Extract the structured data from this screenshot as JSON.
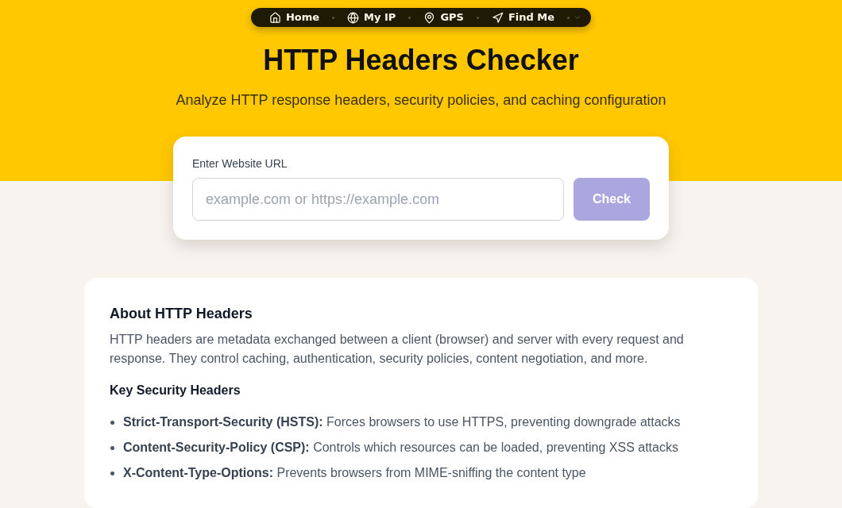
{
  "nav": {
    "items": [
      {
        "label": "Home"
      },
      {
        "label": "My IP"
      },
      {
        "label": "GPS"
      },
      {
        "label": "Find Me"
      }
    ]
  },
  "hero": {
    "title": "HTTP Headers Checker",
    "subtitle": "Analyze HTTP response headers, security policies, and caching configuration"
  },
  "url_form": {
    "label": "Enter Website URL",
    "placeholder": "example.com or https://example.com",
    "button": {
      "label": "Check",
      "disabled": true
    }
  },
  "about": {
    "title": "About HTTP Headers",
    "text": "HTTP headers are metadata exchanged between a client (browser) and server with every request and response. They control caching, authentication, security policies, content negotiation, and more.",
    "subtitle": "Key Security Headers",
    "items": [
      "**Strict-Transport-Security (HSTS):** Forces browsers to use HTTPS, preventing downgrade attacks",
      "**Content-Security-Policy (CSP):** Controls which resources can be loaded, preventing XSS attacks",
      "**X-Content-Type-Options:** Prevents browsers from MIME-sniffing the content type"
    ]
  }
}
